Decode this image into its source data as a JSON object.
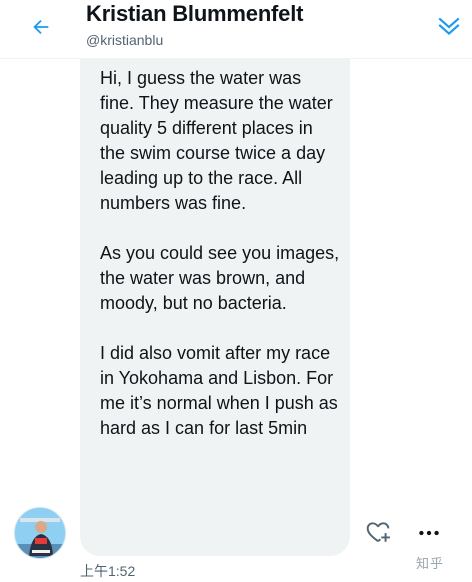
{
  "header": {
    "name": "Kristian Blummenfelt",
    "handle": "@kristianblu",
    "back_icon": "arrow-left-icon",
    "collapse_icon": "double-chevron-down-icon"
  },
  "message": {
    "paragraphs": [
      "Hi, I guess the water was fine. They measure the water quality 5 different places in the swim course twice a day leading up to the race. All numbers was fine.",
      "As you could see you images, the water was brown, and moody, but no bacteria.",
      "I did also vomit after my race in Yokohama and Lisbon. For me it’s normal when I push as hard as I can for last 5min"
    ],
    "timestamp": "上午1:52"
  },
  "actions": {
    "react_icon": "heart-plus-icon",
    "more_icon": "more-horizontal-icon"
  },
  "watermark": "知乎",
  "colors": {
    "accent": "#1d9bf0",
    "bubble": "#eff3f4",
    "text": "#0f1419",
    "secondary": "#536471"
  }
}
